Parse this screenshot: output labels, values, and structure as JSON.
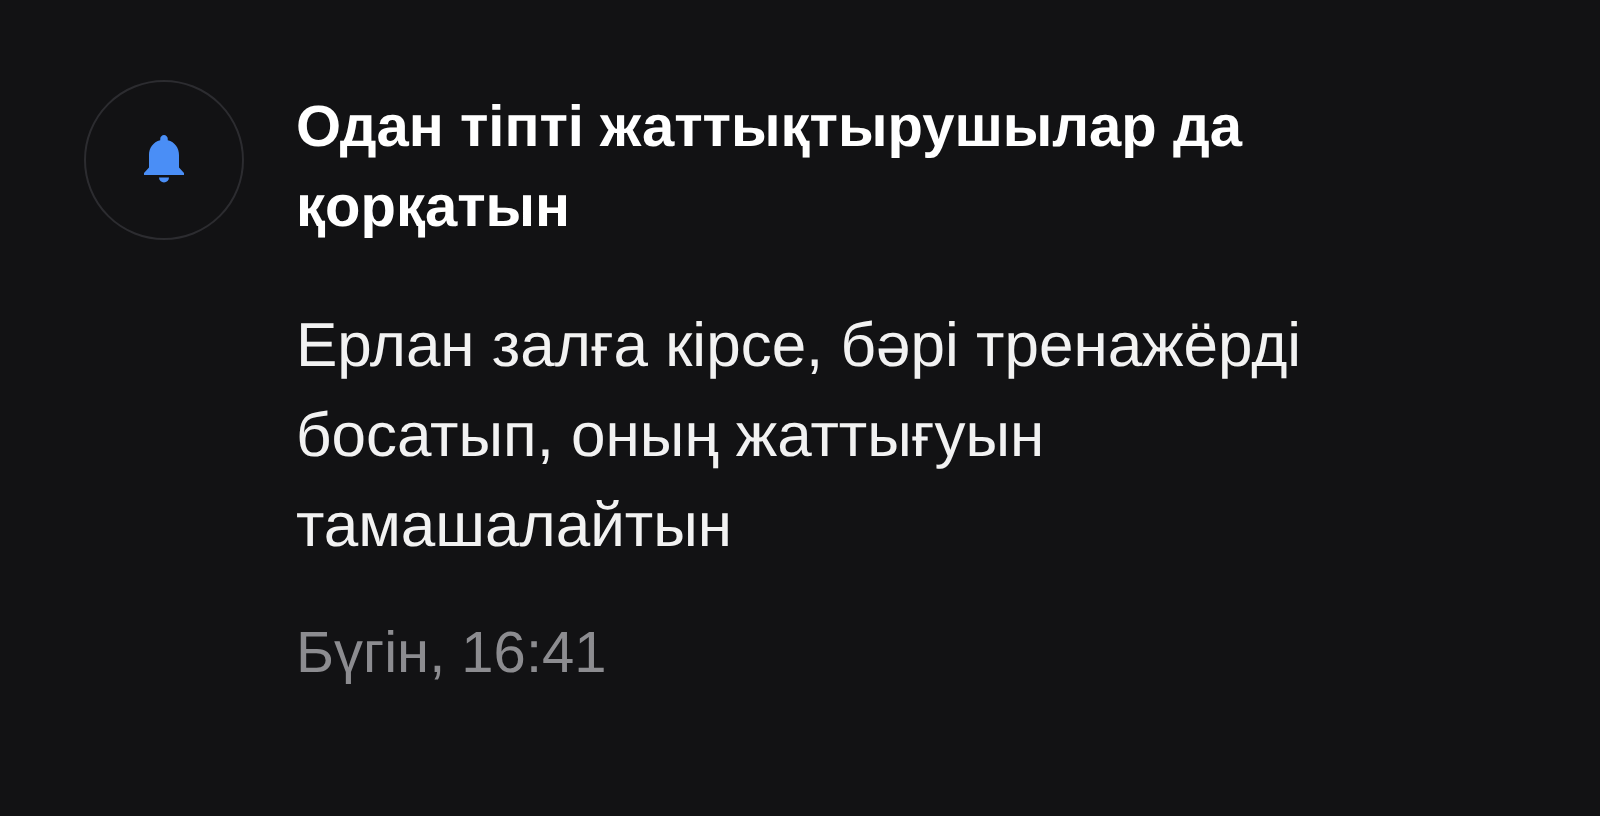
{
  "notification": {
    "title": "Одан тіпті жаттықтырушылар да қорқатын",
    "body": "Ерлан залға кірсе, бәрі тренажёрді босатып, оның жаттығуын тамашалайтын",
    "time": "Бүгін, 16:41"
  }
}
